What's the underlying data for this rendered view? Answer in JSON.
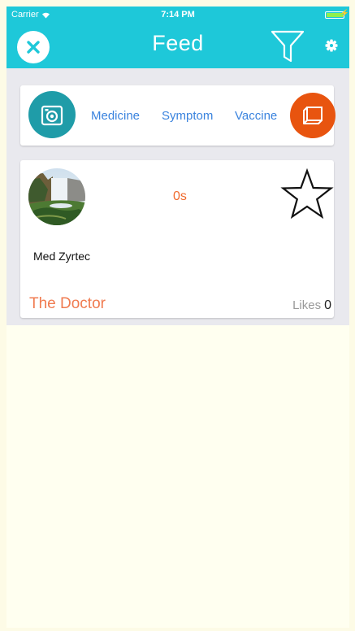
{
  "status_bar": {
    "carrier": "Carrier",
    "time": "7:14 PM"
  },
  "nav": {
    "title": "Feed",
    "close_icon": "close-icon",
    "filter_icon": "filter-icon",
    "settings_icon": "gear-icon"
  },
  "categories": {
    "items": [
      "Medicine",
      "Symptom",
      "Vaccine"
    ],
    "left_icon": "camera-icon",
    "right_icon": "book-icon"
  },
  "post": {
    "time_ago": "0s",
    "text": "Med Zyrtec",
    "author": "The Doctor",
    "likes_label": "Likes",
    "likes_count": "0",
    "favorite_icon": "star-icon"
  },
  "colors": {
    "nav_bar": "#1ec8d9",
    "link_blue": "#3a83de",
    "accent_orange": "#f06b2e",
    "camera_teal": "#1f9ca8",
    "book_orange": "#e8540f",
    "page_background": "#fffff0"
  }
}
